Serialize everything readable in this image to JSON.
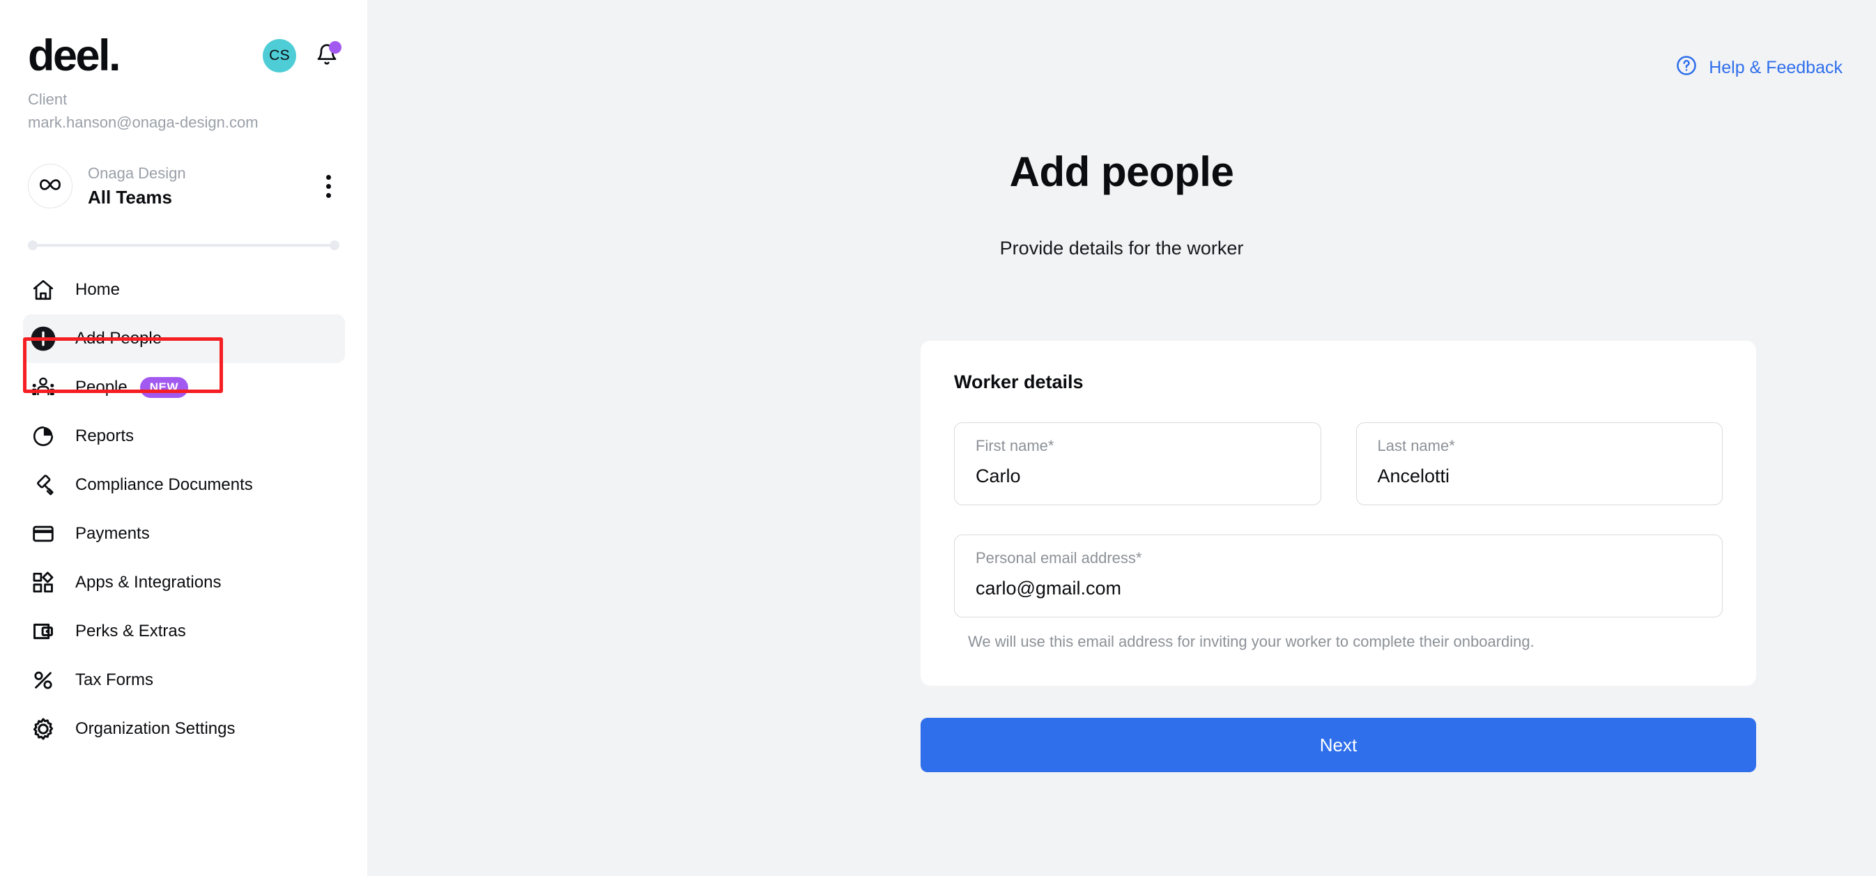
{
  "sidebar": {
    "logo_text": "deel.",
    "avatar_initials": "CS",
    "role_label": "Client",
    "user_email": "mark.hanson@onaga-design.com",
    "team": {
      "org_name": "Onaga Design",
      "selected_team": "All Teams",
      "logo_icon": "infinity-icon",
      "menu_icon": "kebab-menu-icon"
    },
    "notification_icon": "bell-icon",
    "nav_items": [
      {
        "label": "Home",
        "icon": "home-icon",
        "active": false,
        "badge": null
      },
      {
        "label": "Add People",
        "icon": "plus-circle-icon",
        "active": true,
        "badge": null
      },
      {
        "label": "People",
        "icon": "people-group-icon",
        "active": false,
        "badge": "NEW"
      },
      {
        "label": "Reports",
        "icon": "pie-chart-icon",
        "active": false,
        "badge": null
      },
      {
        "label": "Compliance Documents",
        "icon": "gavel-icon",
        "active": false,
        "badge": null
      },
      {
        "label": "Payments",
        "icon": "credit-card-icon",
        "active": false,
        "badge": null
      },
      {
        "label": "Apps & Integrations",
        "icon": "apps-grid-icon",
        "active": false,
        "badge": null
      },
      {
        "label": "Perks & Extras",
        "icon": "wallet-icon",
        "active": false,
        "badge": null
      },
      {
        "label": "Tax Forms",
        "icon": "percent-icon",
        "active": false,
        "badge": null
      },
      {
        "label": "Organization Settings",
        "icon": "gear-icon",
        "active": false,
        "badge": null
      }
    ]
  },
  "main": {
    "help_link": {
      "label": "Help & Feedback",
      "icon": "question-circle-icon"
    },
    "page_title": "Add people",
    "page_subtitle": "Provide details for the worker",
    "card": {
      "title": "Worker details",
      "fields": [
        {
          "label": "First name*",
          "value": "Carlo"
        },
        {
          "label": "Last name*",
          "value": "Ancelotti"
        },
        {
          "label": "Personal email address*",
          "value": "carlo@gmail.com"
        }
      ],
      "email_helper_text": "We will use this email address for inviting your worker to complete their onboarding."
    },
    "next_button_label": "Next"
  },
  "colors": {
    "accent_blue": "#2f6fec",
    "avatar_teal": "#4ecdd6",
    "badge_purple": "#a259f0",
    "highlight_red": "#f51f23",
    "main_bg": "#f2f3f5"
  }
}
